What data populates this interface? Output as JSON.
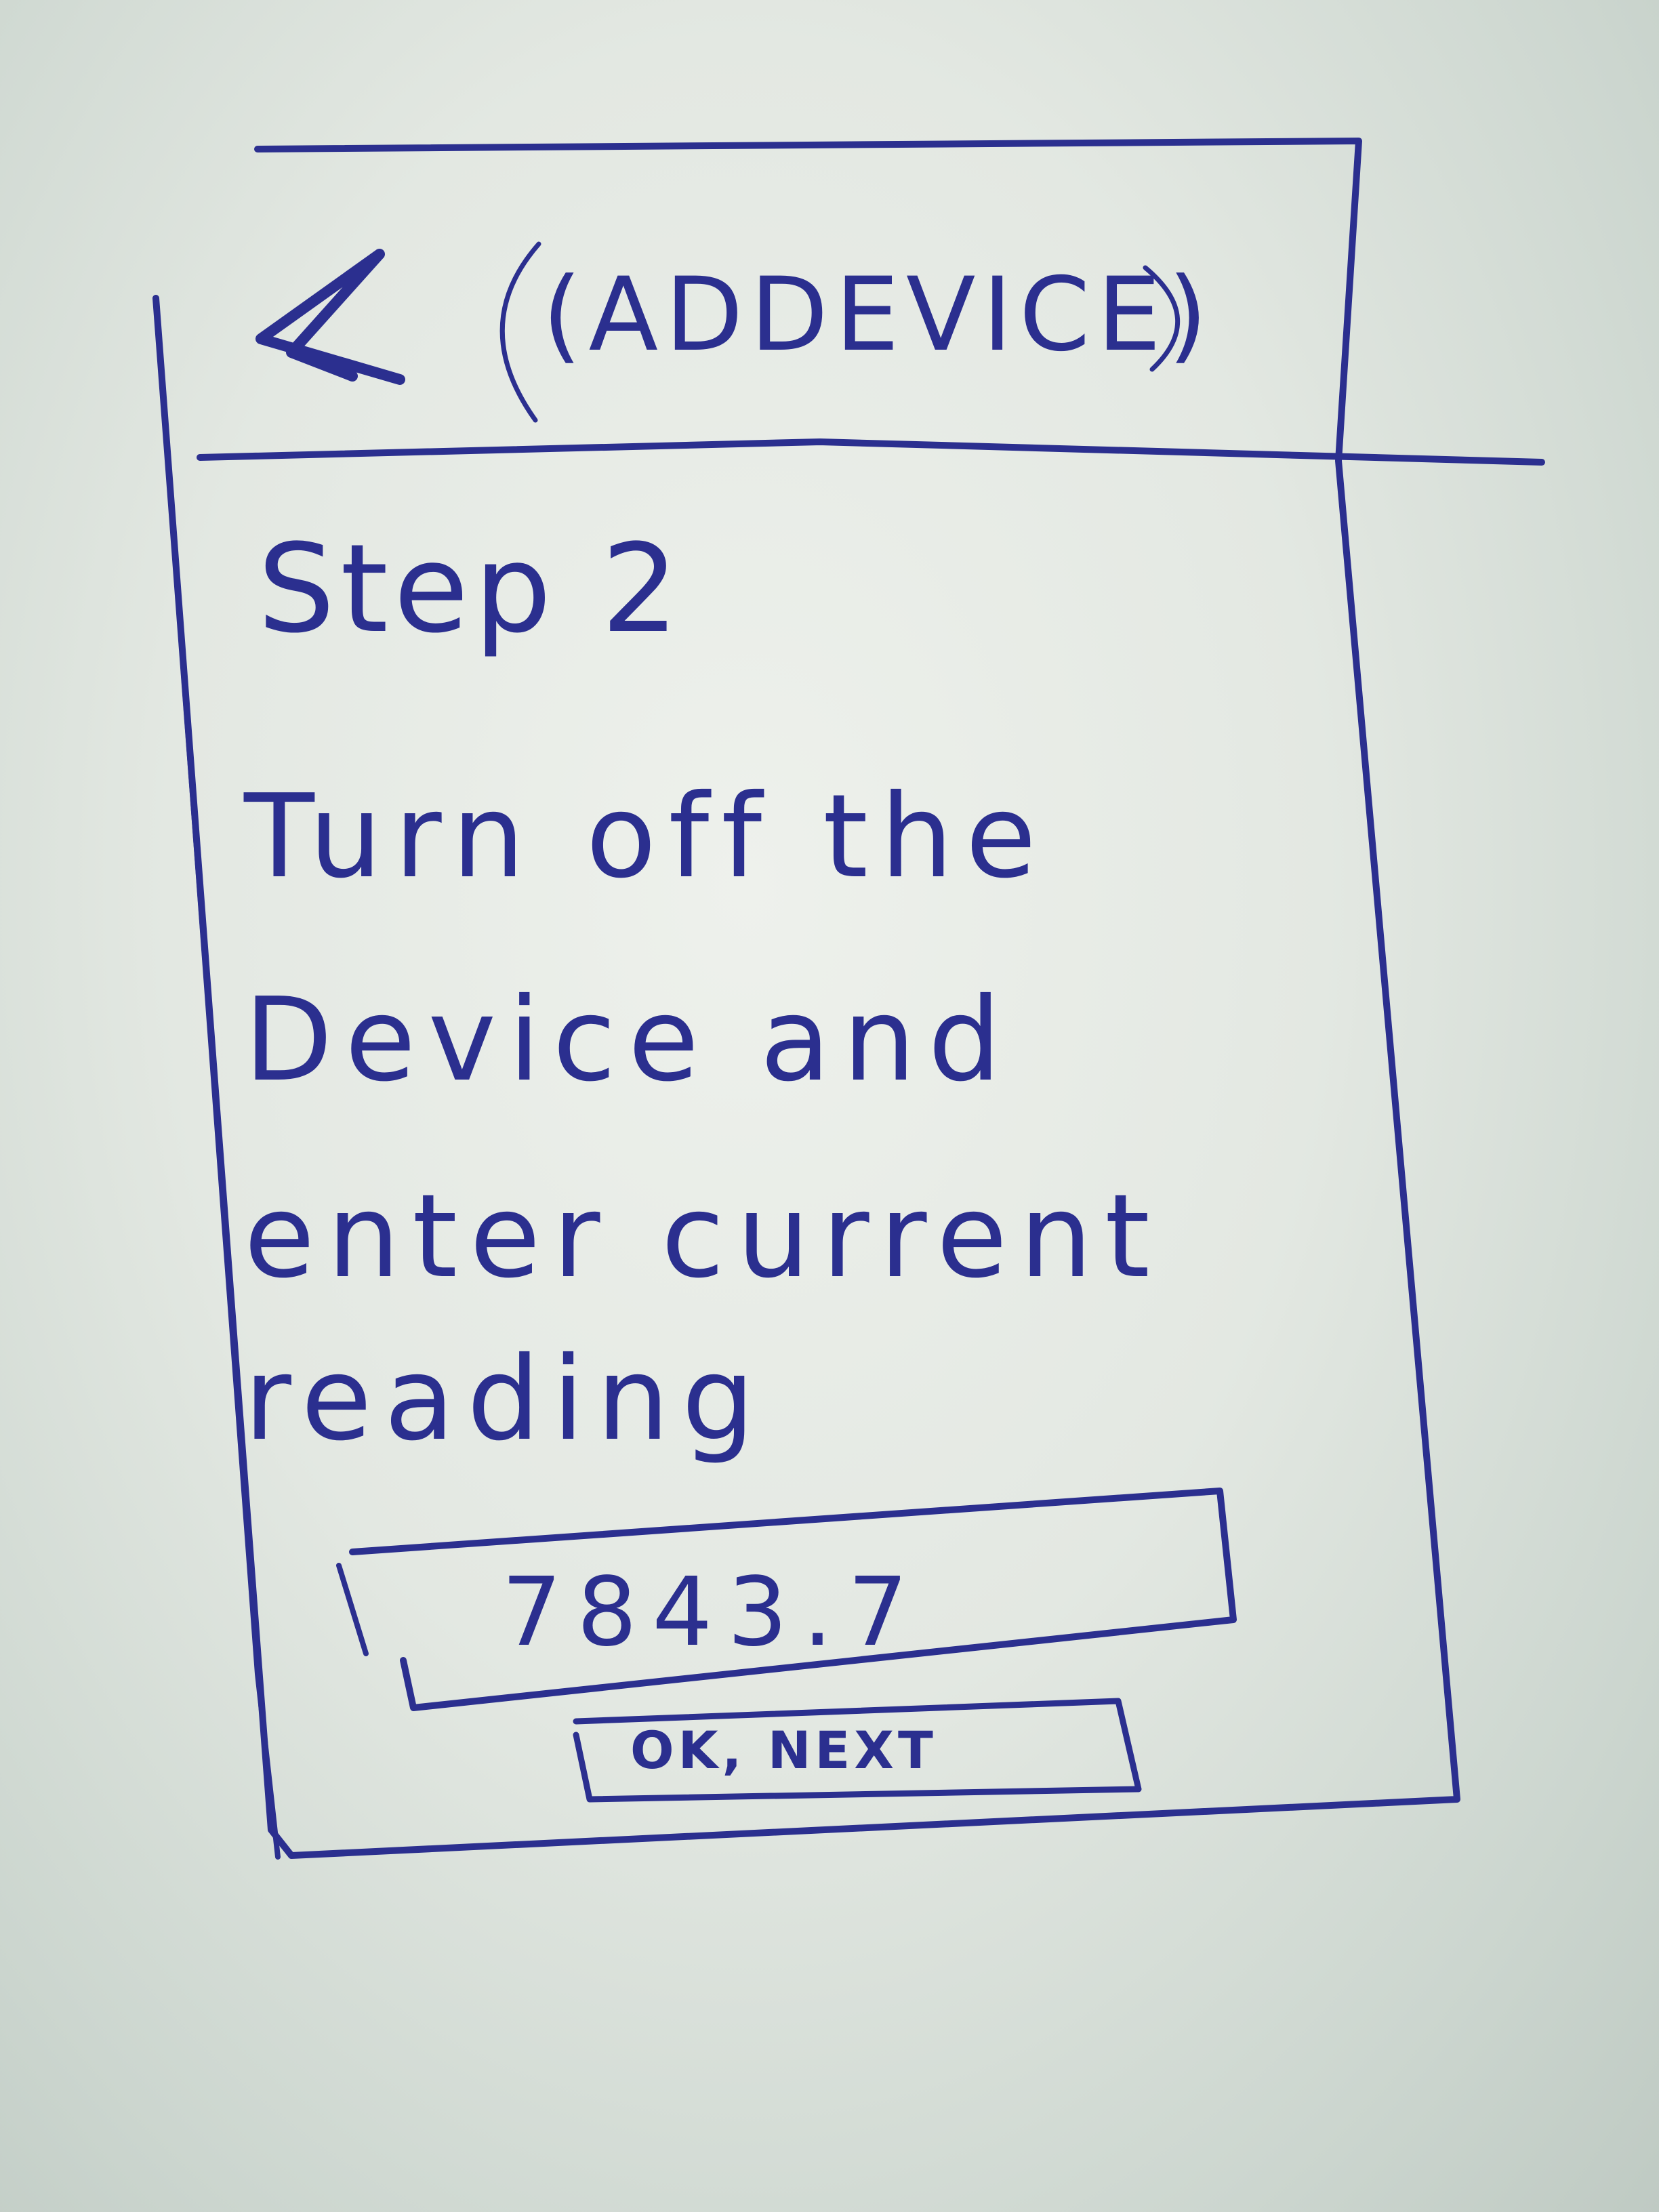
{
  "header": {
    "back_icon": "chevron-left-icon",
    "title": "(ADDEVICE)"
  },
  "step": {
    "label": "Step 2"
  },
  "instructions": {
    "line1": "Turn off the",
    "line2": "Device and",
    "line3": "enter current",
    "line4": "reading"
  },
  "reading_input": {
    "value": "7843.7"
  },
  "next_button": {
    "label": "OK, NEXT"
  },
  "colors": {
    "ink": "#2b2f8f",
    "paper": "#e3e8e2"
  }
}
